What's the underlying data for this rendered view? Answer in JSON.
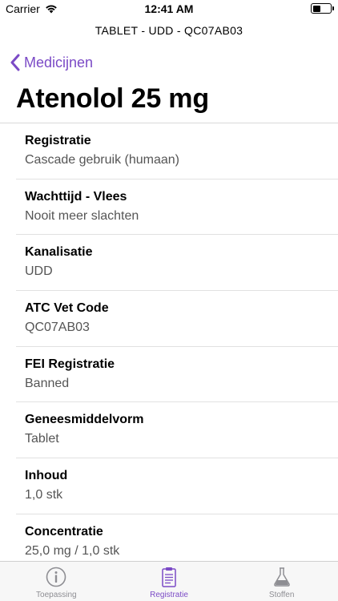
{
  "status": {
    "carrier": "Carrier",
    "time": "12:41 AM"
  },
  "nav": {
    "subtitle": "TABLET - UDD - QC07AB03",
    "back_label": "Medicijnen",
    "title": "Atenolol 25 mg"
  },
  "rows": [
    {
      "label": "Registratie",
      "value": "Cascade gebruik (humaan)"
    },
    {
      "label": "Wachttijd - Vlees",
      "value": "Nooit meer slachten"
    },
    {
      "label": "Kanalisatie",
      "value": "UDD"
    },
    {
      "label": "ATC Vet Code",
      "value": "QC07AB03"
    },
    {
      "label": "FEI Registratie",
      "value": "Banned"
    },
    {
      "label": "Geneesmiddelvorm",
      "value": "Tablet"
    },
    {
      "label": "Inhoud",
      "value": "1,0 stk"
    },
    {
      "label": "Concentratie",
      "value": "25,0 mg / 1,0 stk"
    }
  ],
  "tabs": [
    {
      "label": "Toepassing",
      "icon": "info-icon"
    },
    {
      "label": "Registratie",
      "icon": "clipboard-icon",
      "active": true
    },
    {
      "label": "Stoffen",
      "icon": "flask-icon"
    }
  ],
  "colors": {
    "accent": "#7b4ac6",
    "inactive": "#8e8e93"
  }
}
